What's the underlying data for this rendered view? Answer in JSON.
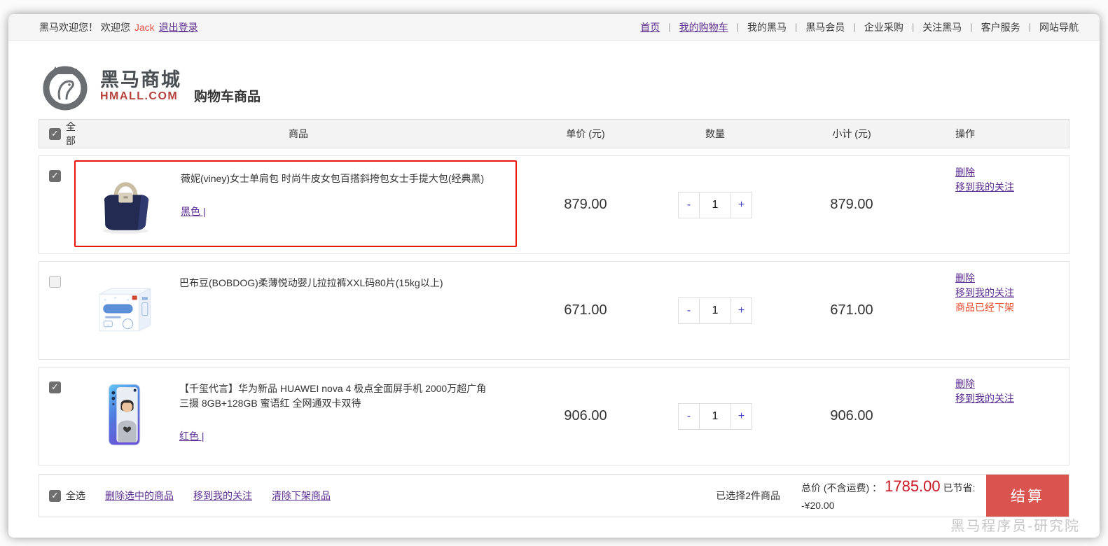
{
  "topbar": {
    "welcome_prefix": "黑马欢迎您！ 欢迎您",
    "username": "Jack",
    "logout": "退出登录",
    "nav": [
      "首页",
      "我的购物车",
      "我的黑马",
      "黑马会员",
      "企业采购",
      "关注黑马",
      "客户服务",
      "网站导航"
    ]
  },
  "header": {
    "brand_name": "黑马商城",
    "brand_domain": "HMALL.COM",
    "page_title": "购物车商品"
  },
  "table": {
    "headers": {
      "select_all": "全部",
      "product": "商品",
      "unit_price": "单价 (元)",
      "quantity": "数量",
      "subtotal": "小计 (元)",
      "actions": "操作"
    }
  },
  "stepper": {
    "minus": "-",
    "plus": "+"
  },
  "items": [
    {
      "title": "薇妮(viney)女士单肩包 时尚牛皮女包百搭斜挎包女士手提大包(经典黑)",
      "variant": "黑色 |",
      "price": "879.00",
      "qty": "1",
      "subtotal": "879.00",
      "checked": true,
      "highlighted": true,
      "actions": [
        "删除",
        "移到我的关注"
      ]
    },
    {
      "title": "巴布豆(BOBDOG)柔薄悦动婴儿拉拉裤XXL码80片(15kg以上)",
      "variant": "",
      "price": "671.00",
      "qty": "1",
      "subtotal": "671.00",
      "checked": false,
      "highlighted": false,
      "actions": [
        "删除",
        "移到我的关注"
      ],
      "status": "商品已经下架"
    },
    {
      "title": "【千玺代言】华为新品 HUAWEI nova 4 极点全面屏手机 2000万超广角三摄 8GB+128GB 蜜语红 全网通双卡双待",
      "variant": "红色 |",
      "price": "906.00",
      "qty": "1",
      "subtotal": "906.00",
      "checked": true,
      "highlighted": false,
      "actions": [
        "删除",
        "移到我的关注"
      ]
    }
  ],
  "footer": {
    "select_all": "全选",
    "links": [
      "删除选中的商品",
      "移到我的关注",
      "清除下架商品"
    ],
    "selected_count": "已选择2件商品",
    "total_label": "总价 (不含运费) ：",
    "total_value": "1785.00",
    "savings": "已节省: -¥20.00",
    "checkout": "结算"
  },
  "watermark": "黑马程序员-研究院",
  "colors": {
    "link_purple": "#5b2d90",
    "username_red": "#e4574b",
    "price_red": "#c81623",
    "checkout_button_red": "#d9534f",
    "highlight_border_red": "#e8160c",
    "status_red": "#e4502f"
  }
}
